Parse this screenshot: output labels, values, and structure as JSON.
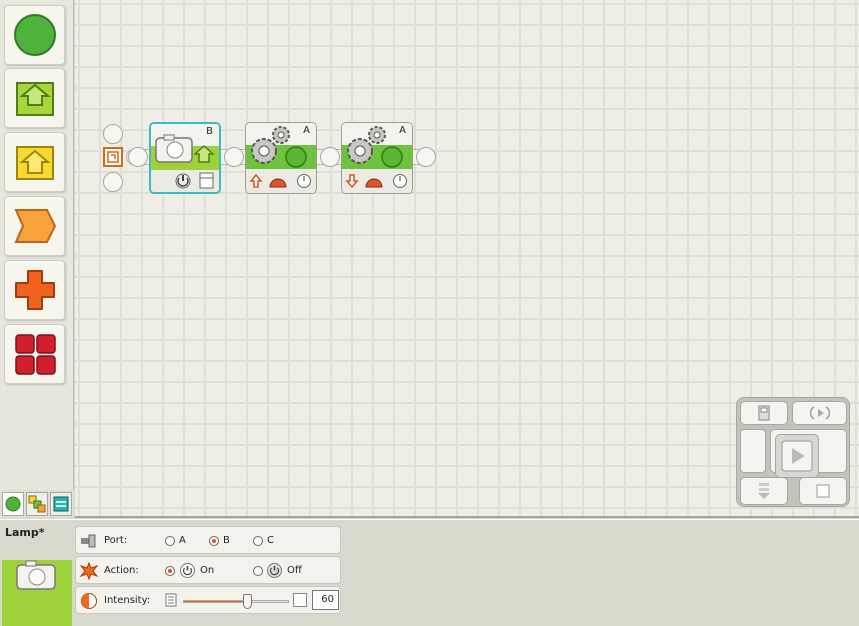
{
  "palette": {
    "items": [
      {
        "name": "common-palette-action",
        "shape": "green-circle"
      },
      {
        "name": "up-arrow-green",
        "shape": "green-up-arrow"
      },
      {
        "name": "up-arrow-yellow",
        "shape": "yellow-up-arrow"
      },
      {
        "name": "chevron-orange",
        "shape": "orange-chevron"
      },
      {
        "name": "cross-orange",
        "shape": "orange-cross"
      },
      {
        "name": "grid-red",
        "shape": "red-grid"
      }
    ],
    "tabs": [
      "common-palette",
      "complete-palette",
      "custom-palette"
    ]
  },
  "program": {
    "blocks": [
      {
        "type": "lamp",
        "port": "B",
        "selected": true
      },
      {
        "type": "motor",
        "port": "A",
        "direction": "forward"
      },
      {
        "type": "motor",
        "port": "A",
        "direction": "reverse"
      }
    ]
  },
  "config": {
    "title": "Lamp*",
    "port": {
      "label": "Port:",
      "options": [
        "A",
        "B",
        "C"
      ],
      "selected": "B"
    },
    "action": {
      "label": "Action:",
      "options": [
        "On",
        "Off"
      ],
      "selected": "On"
    },
    "intensity": {
      "label": "Intensity:",
      "value": "60",
      "percent": 60
    }
  },
  "colors": {
    "accent_green": "#6ec23e",
    "lamp_green": "#9fd23a",
    "slider_orange": "#f06a1a",
    "selection_teal": "#3bbac7"
  }
}
